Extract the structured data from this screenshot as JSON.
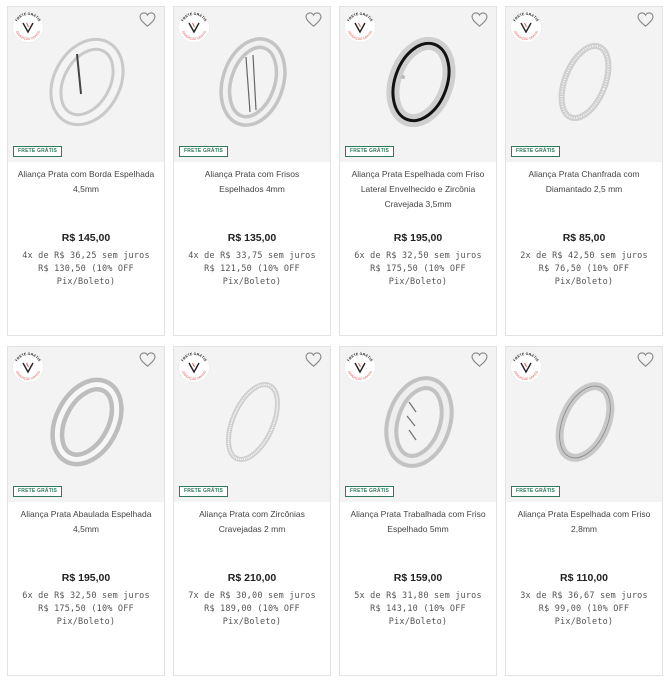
{
  "seal": {
    "top_text": "FRETE GRÁTIS",
    "bottom_text": "GRAVAÇÃO GRÁTIS"
  },
  "colors": {
    "badge_green": "#2c7a5a",
    "seal_red": "#e25b5b",
    "card_border": "#e2e2e2",
    "image_bg": "#f3f3f3"
  },
  "icons": {
    "favorite": "heart-outline-icon",
    "seal": "v-logo-icon"
  },
  "products": [
    {
      "badge": "FRETE GRÁTIS",
      "name": "Aliança Prata com Borda Espelhada 4,5mm",
      "price": "R$ 145,00",
      "installments": "4x de R$ 36,25 sem juros",
      "pix": "R$ 130,50 (10% OFF Pix/Boleto)"
    },
    {
      "badge": "FRETE GRÁTIS",
      "name": "Aliança Prata com Frisos Espelhados 4mm",
      "price": "R$ 135,00",
      "installments": "4x de R$ 33,75 sem juros",
      "pix": "R$ 121,50 (10% OFF Pix/Boleto)"
    },
    {
      "badge": "FRETE GRÁTIS",
      "name": "Aliança Prata Espelhada com Friso Lateral Envelhecido e Zircônia Cravejada 3,5mm",
      "price": "R$ 195,00",
      "installments": "6x de R$ 32,50 sem juros",
      "pix": "R$ 175,50 (10% OFF Pix/Boleto)"
    },
    {
      "badge": "FRETE GRÁTIS",
      "name": "Aliança Prata Chanfrada com Diamantado 2,5 mm",
      "price": "R$ 85,00",
      "installments": "2x de R$ 42,50 sem juros",
      "pix": "R$ 76,50 (10% OFF Pix/Boleto)"
    },
    {
      "badge": "FRETE GRÁTIS",
      "name": "Aliança Prata Abaulada Espelhada 4,5mm",
      "price": "R$ 195,00",
      "installments": "6x de R$ 32,50 sem juros",
      "pix": "R$ 175,50 (10% OFF Pix/Boleto)"
    },
    {
      "badge": "FRETE GRÁTIS",
      "name": "Aliança Prata com Zircônias Cravejadas 2 mm",
      "price": "R$ 210,00",
      "installments": "7x de R$ 30,00 sem juros",
      "pix": "R$ 189,00 (10% OFF Pix/Boleto)"
    },
    {
      "badge": "FRETE GRÁTIS",
      "name": "Aliança Prata Trabalhada com Friso Espelhado 5mm",
      "price": "R$ 159,00",
      "installments": "5x de R$ 31,80 sem juros",
      "pix": "R$ 143,10 (10% OFF Pix/Boleto)"
    },
    {
      "badge": "FRETE GRÁTIS",
      "name": "Aliança Prata Espelhada com Friso 2,8mm",
      "price": "R$ 110,00",
      "installments": "3x de R$ 36,67 sem juros",
      "pix": "R$ 99,00 (10% OFF Pix/Boleto)"
    }
  ]
}
